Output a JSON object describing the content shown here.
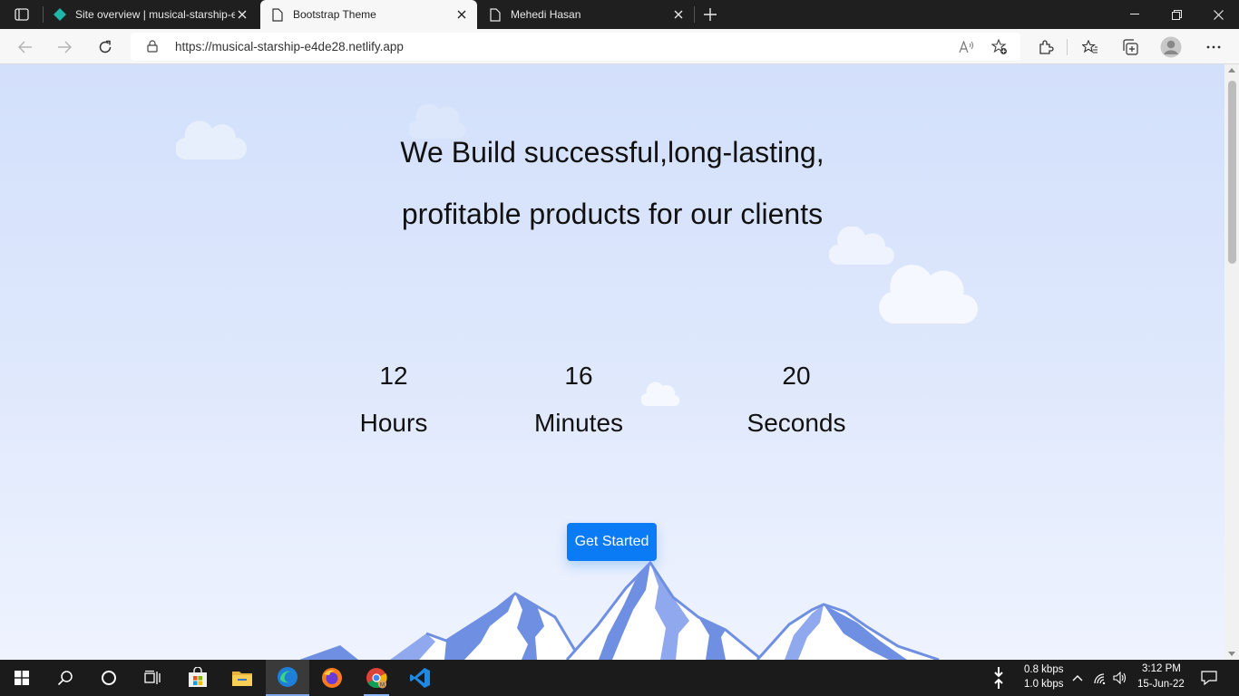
{
  "browser": {
    "tabs": [
      {
        "title": "Site overview | musical-starship-e",
        "active": false
      },
      {
        "title": "Bootstrap Theme",
        "active": true
      },
      {
        "title": "Mehedi Hasan",
        "active": false
      }
    ],
    "url": "https://musical-starship-e4de28.netlify.app"
  },
  "page": {
    "headline_line1": "We Build successful,long-lasting,",
    "headline_line2": "profitable products for our clients",
    "countdown": [
      {
        "value": "12",
        "unit": "Hours"
      },
      {
        "value": "16",
        "unit": "Minutes"
      },
      {
        "value": "20",
        "unit": "Seconds"
      }
    ],
    "cta_label": "Get Started"
  },
  "taskbar": {
    "net_down": "0.8 kbps",
    "net_up": "1.0 kbps",
    "time": "3:12 PM",
    "date": "15-Jun-22"
  },
  "colors": {
    "accent": "#0b7af5",
    "mountain": "#6f8fe3",
    "sky_top": "#d3e0fb"
  }
}
